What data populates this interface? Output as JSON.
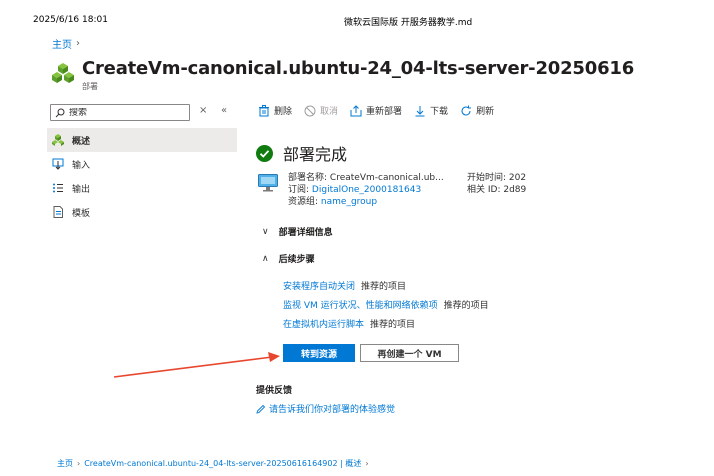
{
  "print_header": {
    "datetime": "2025/6/16 18:01",
    "doc_title": "微软云国际版 开服务器教学.md"
  },
  "breadcrumb": {
    "home": "主页",
    "sep": "›"
  },
  "page": {
    "title": "CreateVm-canonical.ubuntu-24_04-lts-server-20250616",
    "subtitle": "部署"
  },
  "sidebar": {
    "search_placeholder": "搜索",
    "close_glyph": "×",
    "collapse_glyph": "«",
    "items": [
      {
        "label": "概述",
        "icon": "overview-icon"
      },
      {
        "label": "输入",
        "icon": "inputs-icon"
      },
      {
        "label": "输出",
        "icon": "outputs-icon"
      },
      {
        "label": "模板",
        "icon": "template-icon"
      }
    ]
  },
  "toolbar": {
    "delete": "删除",
    "cancel": "取消",
    "redeploy": "重新部署",
    "download": "下载",
    "refresh": "刷新"
  },
  "status": {
    "title": "部署完成",
    "color": "#107c10"
  },
  "deployment": {
    "name_label": "部署名称:",
    "name_value": "CreateVm-canonical.ub...",
    "subscription_label": "订阅:",
    "subscription_value": "DigitalOne_2000181643",
    "resource_group_label": "资源组:",
    "resource_group_value": "name_group",
    "start_time_label": "开始时间:",
    "start_time_value": "202",
    "correlation_label": "相关 ID:",
    "correlation_value": "2d89"
  },
  "sections": {
    "details": {
      "label": "部署详细信息",
      "chevron": "∨"
    },
    "next_steps": {
      "label": "后续步骤",
      "chevron": "∧"
    }
  },
  "next_steps": [
    {
      "link": "安装程序自动关闭",
      "tag": "推荐的项目"
    },
    {
      "link": "监视 VM 运行状况、性能和网络依赖项",
      "tag": "推荐的项目"
    },
    {
      "link": "在虚拟机内运行脚本",
      "tag": "推荐的项目"
    }
  ],
  "actions": {
    "go_to_resource": "转到资源",
    "create_another": "再创建一个 VM"
  },
  "feedback": {
    "title": "提供反馈",
    "link": "请告诉我们你对部署的体验感觉"
  },
  "footer": {
    "home": "主页",
    "resource": "CreateVm-canonical.ubuntu-24_04-lts-server-20250616164902 | 概述",
    "sep": "›"
  },
  "colors": {
    "accent": "#0078d4",
    "arrow": "#e8472f",
    "success": "#107c10"
  }
}
